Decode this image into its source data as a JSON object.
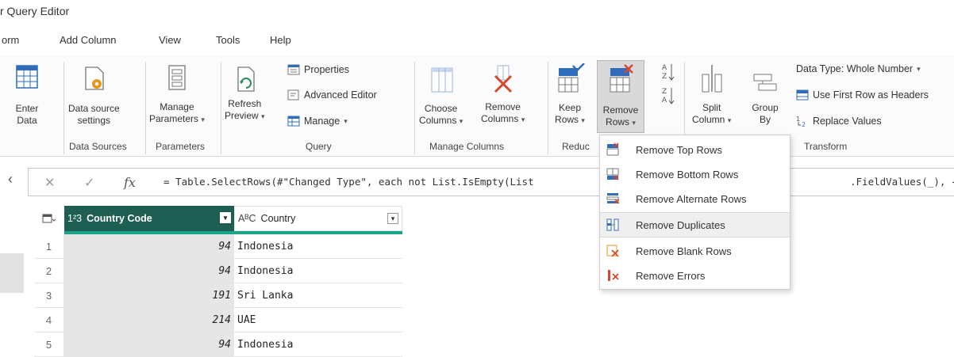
{
  "window": {
    "title": "r Query Editor"
  },
  "menu": [
    "orm",
    "Add Column",
    "View",
    "Tools",
    "Help"
  ],
  "ribbon": {
    "enter_data": [
      "Enter",
      "Data"
    ],
    "data_source_settings": [
      "Data source",
      "settings"
    ],
    "data_sources_group": "Data Sources",
    "manage_parameters": [
      "Manage",
      "Parameters"
    ],
    "parameters_group": "Parameters",
    "refresh_preview": [
      "Refresh",
      "Preview"
    ],
    "properties": "Properties",
    "advanced_editor": "Advanced Editor",
    "manage": "Manage",
    "query_group": "Query",
    "choose_columns": [
      "Choose",
      "Columns"
    ],
    "remove_columns": [
      "Remove",
      "Columns"
    ],
    "manage_columns_group": "Manage Columns",
    "keep_rows": [
      "Keep",
      "Rows"
    ],
    "remove_rows": [
      "Remove",
      "Rows"
    ],
    "reduce_group": "Reduc",
    "split_column": [
      "Split",
      "Column"
    ],
    "group_by": [
      "Group",
      "By"
    ],
    "data_type": "Data Type: Whole Number",
    "use_first_row": "Use First Row as Headers",
    "replace_values": "Replace Values",
    "transform_group": "Transform"
  },
  "formula": {
    "text": "= Table.SelectRows(#\"Changed Type\", each not List.IsEmpty(List",
    "text_right": ".FieldValues(_), {\"\","
  },
  "columns": [
    {
      "type_icon": "1²3",
      "name": "Country Code"
    },
    {
      "type_icon": "AᴮC",
      "name": "Country"
    }
  ],
  "rows": [
    {
      "n": "1",
      "code": "94",
      "country": "Indonesia"
    },
    {
      "n": "2",
      "code": "94",
      "country": "Indonesia"
    },
    {
      "n": "3",
      "code": "191",
      "country": "Sri Lanka"
    },
    {
      "n": "4",
      "code": "214",
      "country": "UAE"
    },
    {
      "n": "5",
      "code": "94",
      "country": "Indonesia"
    }
  ],
  "dropdown": [
    "Remove Top Rows",
    "Remove Bottom Rows",
    "Remove Alternate Rows",
    "Remove Duplicates",
    "Remove Blank Rows",
    "Remove Errors"
  ],
  "colors": {
    "accent": "#1aa58a",
    "header_selected": "#1e5e53",
    "selected_column": "#e6e6e6",
    "remove_icon": "#d9472b",
    "table_icon": "#2f6dbb"
  }
}
